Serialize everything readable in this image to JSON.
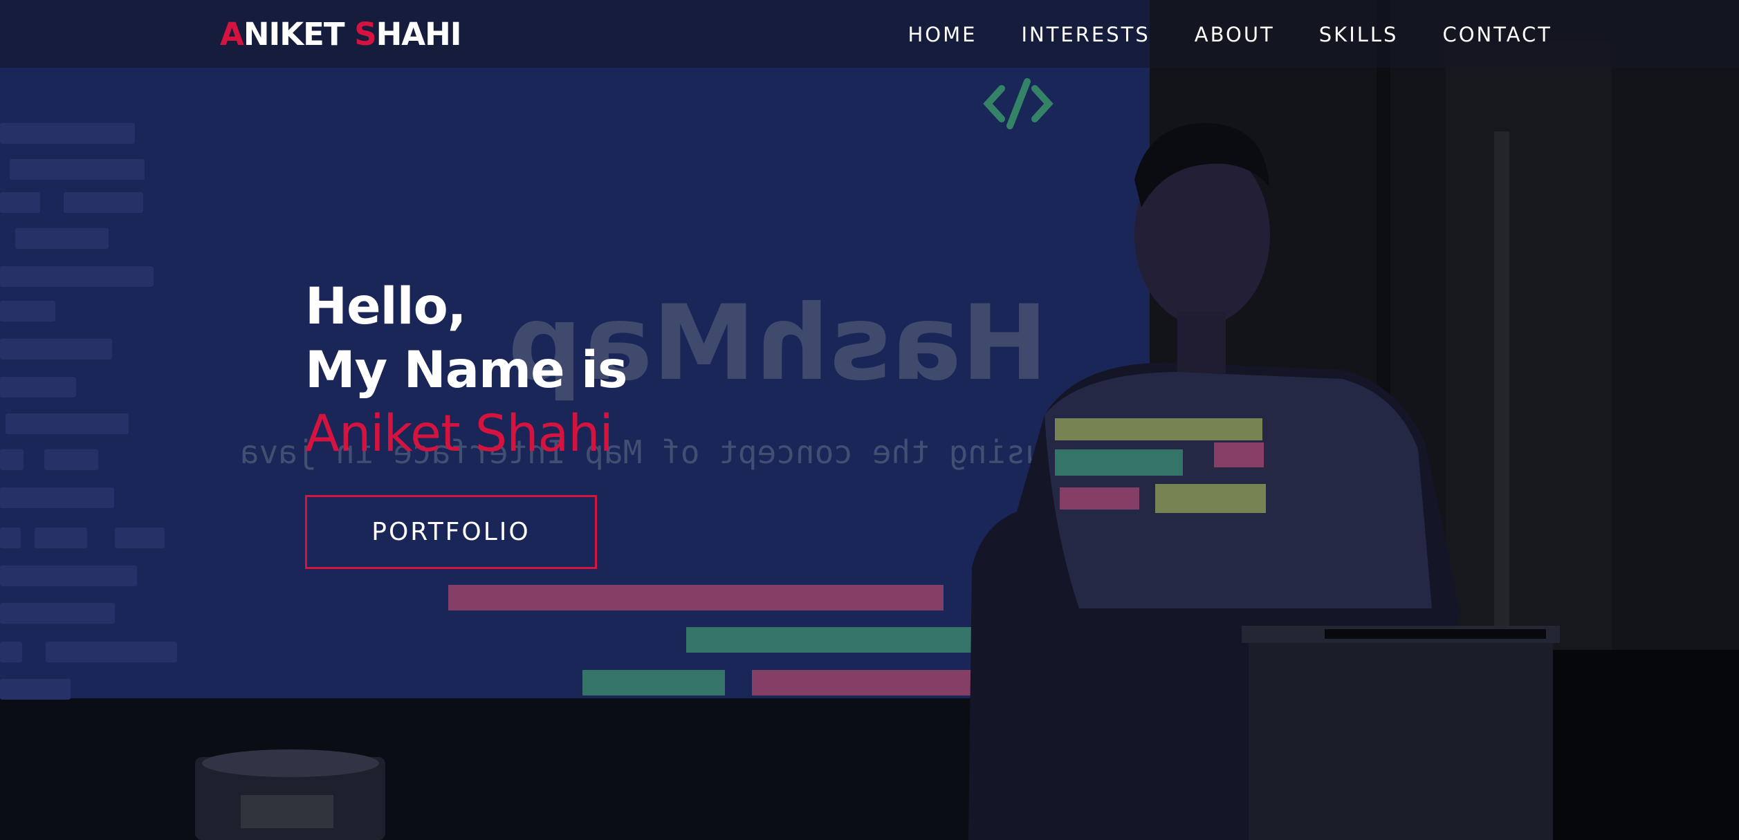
{
  "brand": {
    "first_initial": "A",
    "first_rest": "NIKET ",
    "last_initial": "S",
    "last_rest": "HAHI"
  },
  "nav": {
    "home": "HOME",
    "interests": "INTERESTS",
    "about": "ABOUT",
    "skills": "SKILLS",
    "contact": "CONTACT"
  },
  "hero": {
    "line1": "Hello,",
    "line2": "My Name is",
    "name": "Aniket Shahi",
    "button_label": "PORTFOLIO",
    "background_photo": {
      "slide_title": "HashMap",
      "slide_subtitle": "using the concept of Map Interface in java"
    }
  },
  "colors": {
    "accent": "#d4143f",
    "text": "#ffffff",
    "overlay": "#15192c"
  }
}
